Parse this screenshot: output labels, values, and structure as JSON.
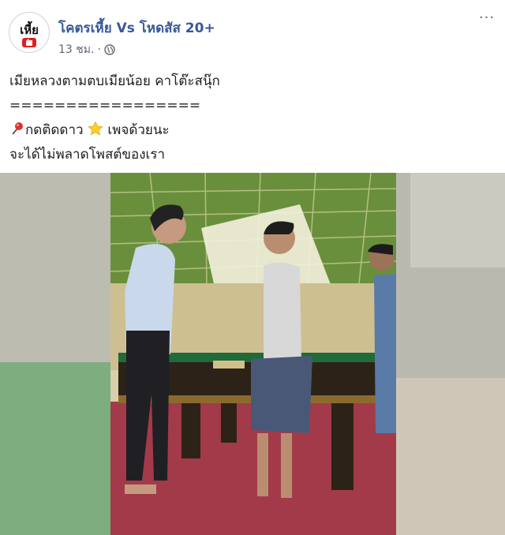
{
  "page": {
    "name": "โคตรเหี้ย Vs โหดสัส 20+",
    "avatar_text": "เหี้ย",
    "timestamp": "13 ชม.",
    "separator": "·",
    "audience_icon": "globe-icon",
    "more_icon": "more-options-icon",
    "more_label": "···"
  },
  "post": {
    "line1": "เมียหลวงตามตบเมียน้อย คาโต๊ะสนุ๊ก",
    "line2": "=================",
    "line3_before": "กดติดดาว",
    "line3_after": "เพจด้วยนะ",
    "line4": "จะได้ไม่พลาดโพสต์ของเรา",
    "pin_icon": "pushpin-icon",
    "star_icon": "star-icon"
  },
  "video": {
    "content_icon": "video-player",
    "colors": {
      "wall": "#d9cfa8",
      "floor": "#a33a4a",
      "table_rail": "#3a2a20",
      "felt": "#1f6b3a"
    }
  },
  "colors": {
    "link": "#385898",
    "meta": "#606770",
    "text": "#1c1e21"
  }
}
